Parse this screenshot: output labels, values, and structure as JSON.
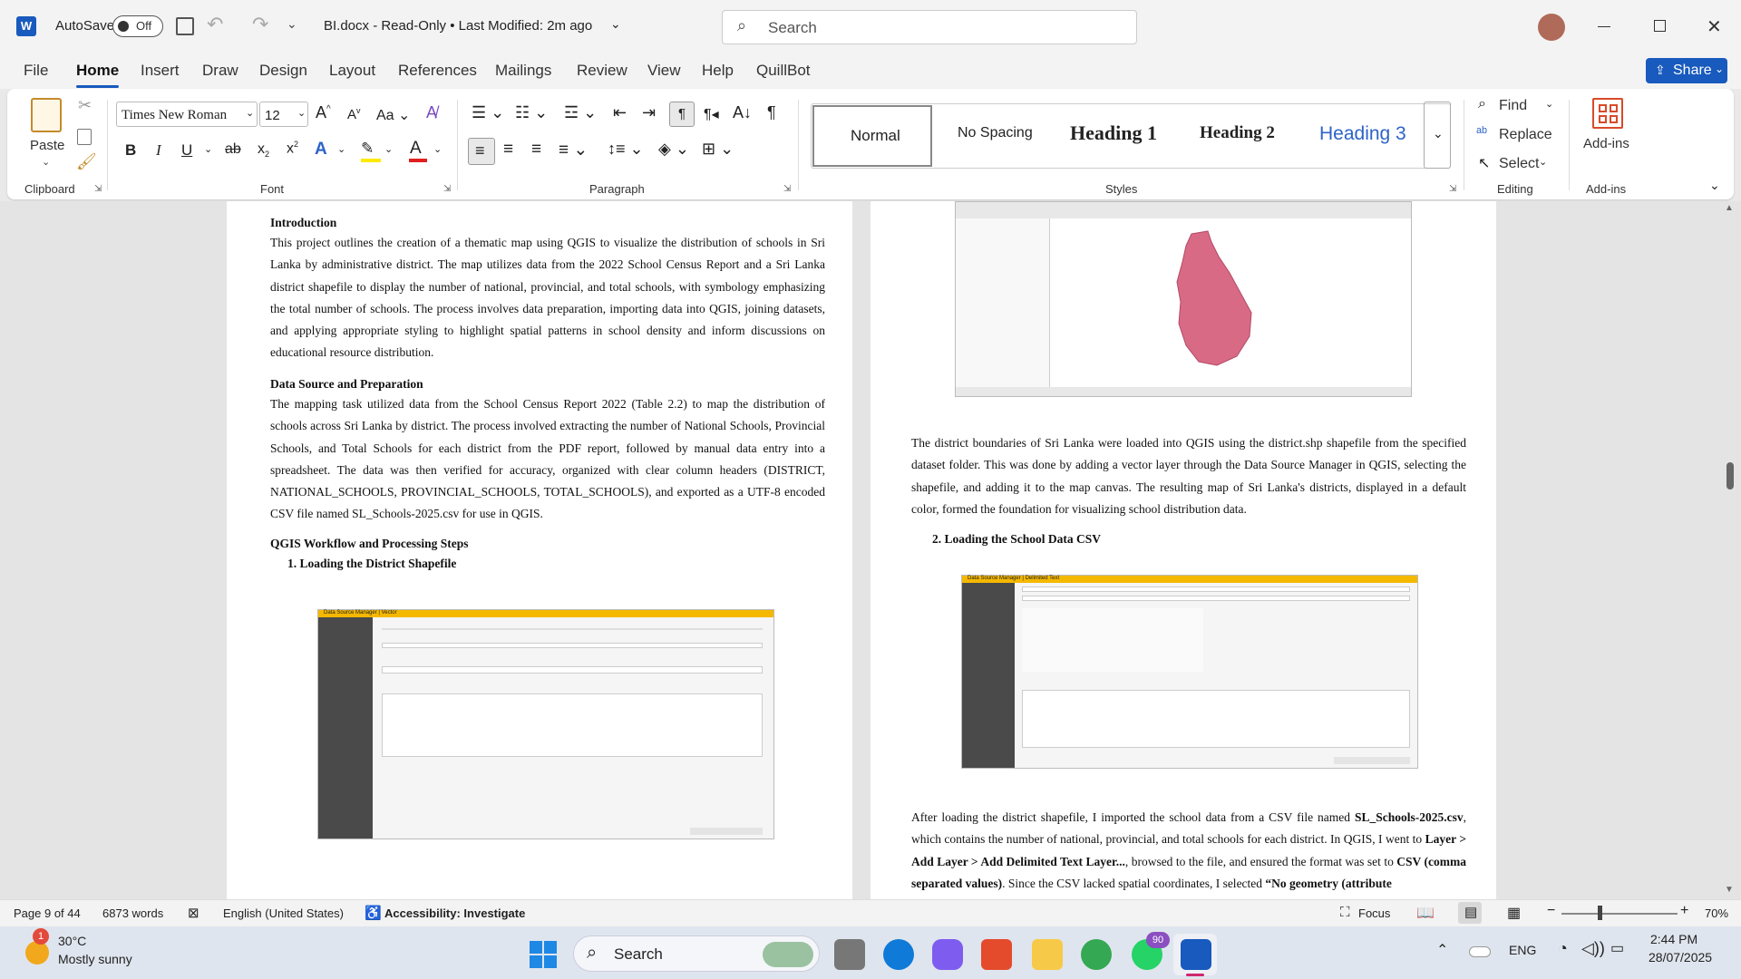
{
  "title_bar": {
    "autosave_label": "AutoSave",
    "autosave_state": "Off",
    "doc_title": "BI.docx - Read-Only • Last Modified: 2m ago",
    "search_placeholder": "Search"
  },
  "tabs": [
    "File",
    "Home",
    "Insert",
    "Draw",
    "Design",
    "Layout",
    "References",
    "Mailings",
    "Review",
    "View",
    "Help",
    "QuillBot"
  ],
  "share_label": "Share",
  "ribbon": {
    "clipboard": {
      "paste": "Paste",
      "group": "Clipboard"
    },
    "font": {
      "name": "Times New Roman",
      "size": "12",
      "group": "Font"
    },
    "paragraph": {
      "group": "Paragraph"
    },
    "styles": {
      "items": [
        "Normal",
        "No Spacing",
        "Heading 1",
        "Heading 2",
        "Heading 3"
      ],
      "group": "Styles"
    },
    "editing": {
      "find": "Find",
      "replace": "Replace",
      "select": "Select",
      "group": "Editing"
    },
    "addins": {
      "label": "Add-ins",
      "group": "Add-ins"
    }
  },
  "page_left": {
    "intro_heading": "Introduction",
    "intro_text": "This project outlines the creation of a thematic map using QGIS to visualize the distribution of schools in Sri Lanka by administrative district. The map utilizes data from the 2022 School Census Report and a Sri Lanka district shapefile to display the number of national, provincial, and total schools, with symbology emphasizing the total number of schools. The process involves data preparation, importing data into QGIS, joining datasets, and applying appropriate styling to highlight spatial patterns in school density and inform discussions on educational resource distribution.",
    "ds_heading": "Data Source and Preparation",
    "ds_text": "The mapping task utilized data from the School Census Report 2022 (Table 2.2) to map the distribution of schools across Sri Lanka by district. The process involved extracting the number of National Schools, Provincial Schools, and Total Schools for each district from the PDF report, followed by manual data entry into a spreadsheet. The data was then verified for accuracy, organized with clear column headers (DISTRICT, NATIONAL_SCHOOLS, PROVINCIAL_SCHOOLS, TOTAL_SCHOOLS), and exported as a UTF-8 encoded CSV file named SL_Schools-2025.csv for use in QGIS.",
    "wf_heading": "QGIS Workflow and Processing Steps",
    "step1": "1.  Loading the District Shapefile",
    "shot_title": "Data Source Manager | Vector"
  },
  "page_right": {
    "para1": "The district boundaries of Sri Lanka were loaded into QGIS using the district.shp shapefile from the specified dataset folder. This was done by adding a vector layer through the Data Source Manager in QGIS, selecting the shapefile, and adding it to the map canvas. The resulting map of Sri Lanka's districts, displayed in a default color, formed the foundation for visualizing school distribution data.",
    "step2": "2.  Loading the School Data CSV",
    "shot_title": "Data Source Manager | Delimited Text",
    "para2_a": "After loading the district shapefile, I imported the school data from a CSV file named ",
    "para2_b": "SL_Schools-2025.csv",
    "para2_c": ", which contains the number of national, provincial, and total schools for each district. In QGIS, I went to ",
    "para2_d": "Layer > Add Layer > Add Delimited Text Layer...",
    "para2_e": ", browsed to the file, and ensured the format was set to ",
    "para2_f": "CSV (comma separated values)",
    "para2_g": ". Since the CSV lacked spatial coordinates, I selected ",
    "para2_h": "“No geometry (attribute"
  },
  "status_bar": {
    "page": "Page 9 of 44",
    "words": "6873 words",
    "language": "English (United States)",
    "accessibility": "Accessibility: Investigate",
    "focus": "Focus",
    "zoom": "70%"
  },
  "taskbar": {
    "weather_temp": "30°C",
    "weather_desc": "Mostly sunny",
    "search": "Search",
    "whatsapp_badge": "90",
    "lang": "ENG",
    "time": "2:44 PM",
    "date": "28/07/2025",
    "weather_badge": "1"
  },
  "colors": {
    "accent": "#185abd",
    "map_fill": "#d96a86",
    "qgis_header": "#f5b800"
  }
}
